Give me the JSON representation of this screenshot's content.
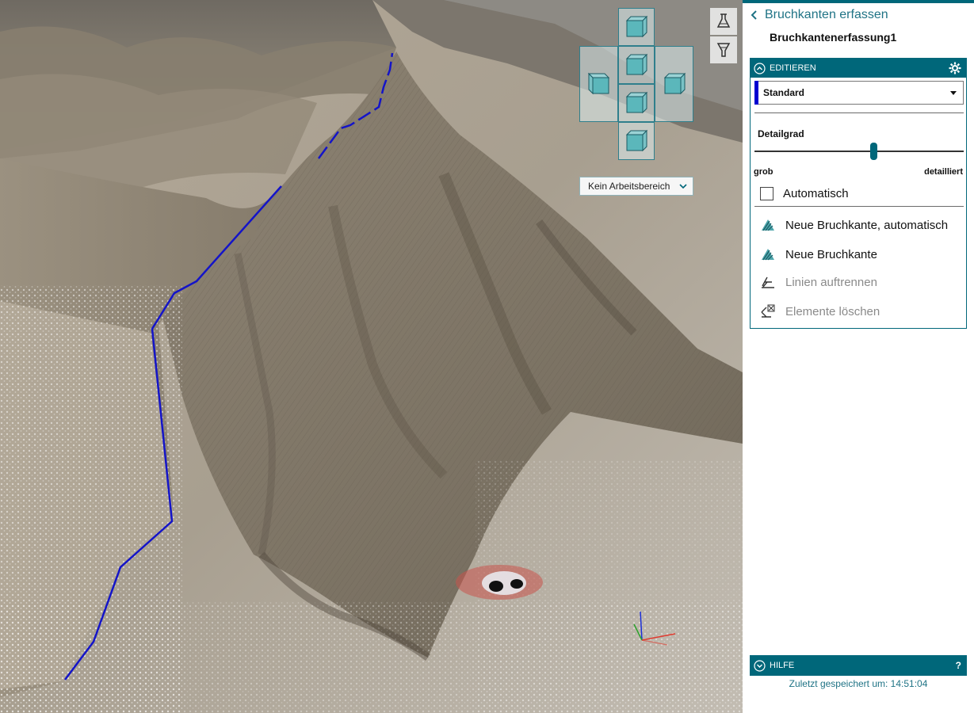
{
  "panel": {
    "back_title": "Bruchkanten erfassen",
    "document_name": "Bruchkantenerfassung1",
    "edit_section": {
      "title": "EDITIEREN",
      "mode_value": "Standard",
      "mode_color": "#0000d0",
      "detail_label": "Detailgrad",
      "detail_level": 0.57,
      "detail_min_label": "grob",
      "detail_max_label": "detailliert",
      "auto_label": "Automatisch",
      "auto_checked": false,
      "actions": [
        {
          "label": "Neue Bruchkante, automatisch",
          "icon": "auto-edge-icon",
          "enabled": true
        },
        {
          "label": "Neue Bruchkante",
          "icon": "edge-icon",
          "enabled": true
        },
        {
          "label": "Linien auftrennen",
          "icon": "split-lines-icon",
          "enabled": false
        },
        {
          "label": "Elemente löschen",
          "icon": "delete-elements-icon",
          "enabled": false
        }
      ]
    },
    "help_section": {
      "title": "HILFE",
      "help_icon": "?"
    },
    "status": "Zuletzt gespeichert um: 14:51:04"
  },
  "viewport": {
    "work_area": "Kein Arbeitsbereich",
    "accent_color": "#00677a",
    "breakline_color": "#1414c8"
  }
}
